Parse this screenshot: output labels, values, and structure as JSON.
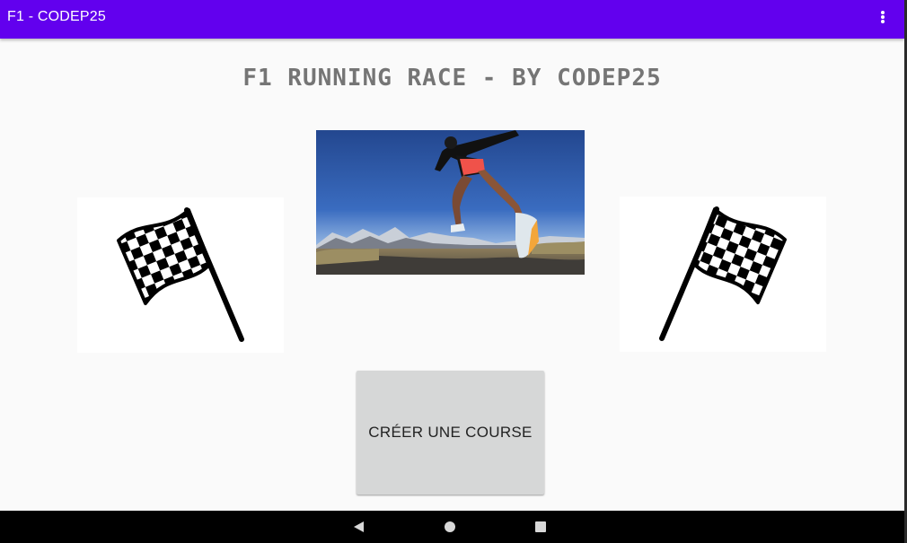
{
  "app_bar": {
    "title": "F1 - CODEP25",
    "background": "#6200ee",
    "overflow_icon": "more-vert-icon"
  },
  "main": {
    "title": "F1 RUNNING RACE - BY CODEP25",
    "left_image": "checkered-flag-icon",
    "center_image": "runner-photo",
    "right_image": "checkered-flag-icon",
    "create_button_label": "CRÉER UNE COURSE"
  },
  "nav_bar": {
    "back_icon": "back-triangle-icon",
    "home_icon": "home-circle-icon",
    "recents_icon": "recents-square-icon"
  }
}
